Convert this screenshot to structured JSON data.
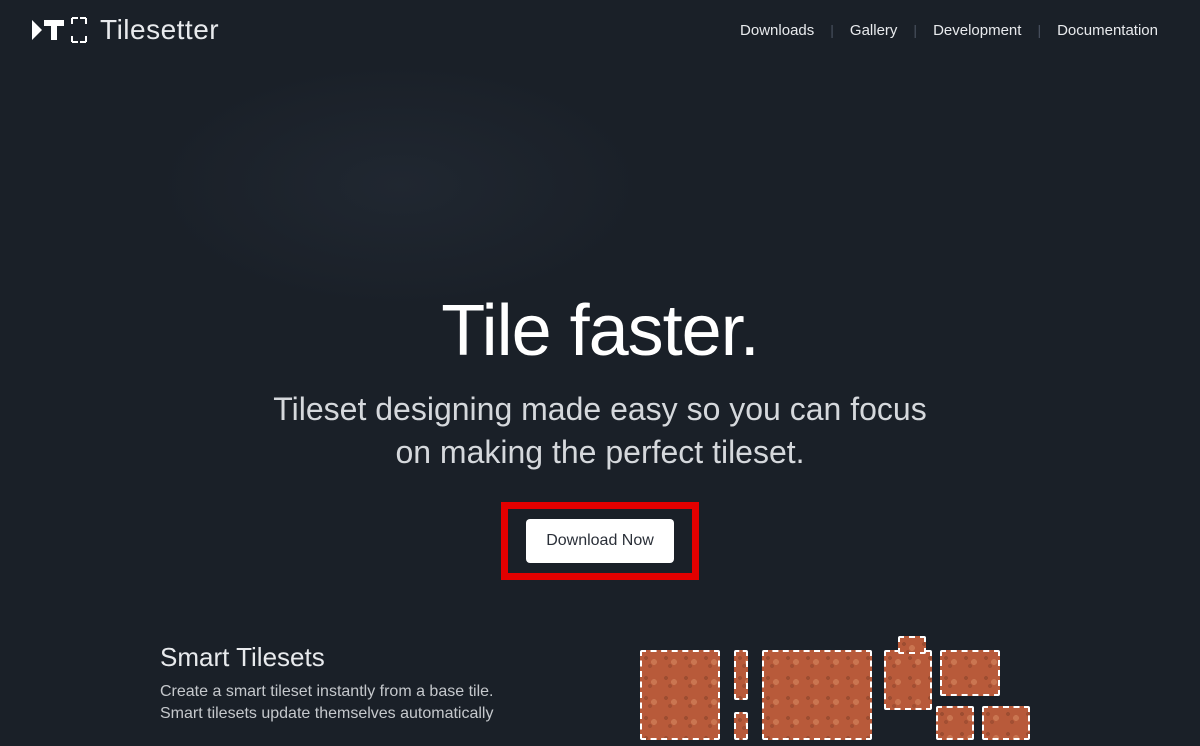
{
  "brand": {
    "name": "Tilesetter"
  },
  "nav": {
    "items": [
      {
        "label": "Downloads"
      },
      {
        "label": "Gallery"
      },
      {
        "label": "Development"
      },
      {
        "label": "Documentation"
      }
    ]
  },
  "hero": {
    "title": "Tile faster.",
    "subtitle": "Tileset designing made easy so you can focus on making the perfect tileset.",
    "cta_label": "Download Now"
  },
  "smart": {
    "title": "Smart Tilesets",
    "description": "Create a smart tileset instantly from a base tile. Smart tilesets update themselves automatically"
  }
}
